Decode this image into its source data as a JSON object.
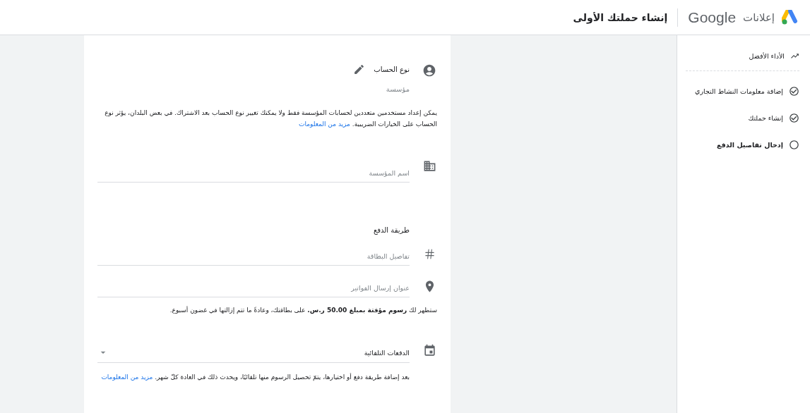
{
  "header": {
    "product": "إعلانات",
    "brand": "Google",
    "title": "إنشاء حملتك الأولى"
  },
  "sidebar": {
    "heading": "الأداء الأفضل",
    "steps": [
      {
        "label": "إضافة معلومات النشاط التجاري",
        "done": true
      },
      {
        "label": "إنشاء حملتك",
        "done": true
      },
      {
        "label": "إدخال تفاصيل الدفع",
        "done": false
      }
    ]
  },
  "form": {
    "account_type": {
      "label": "نوع الحساب",
      "value": "مؤسسة",
      "note": "يمكن إعداد مستخدمين متعددين لحسابات المؤسسة فقط ولا يمكنك تغيير نوع الحساب بعد الاشتراك. في بعض البلدان، يؤثر نوع الحساب على الخيارات الضريبية.",
      "link": "مزيد من المعلومات"
    },
    "organization_name": {
      "placeholder": "اسم المؤسسة"
    },
    "payment": {
      "heading": "طريقة الدفع",
      "card": {
        "placeholder": "تفاصيل البطاقة"
      },
      "billing_address": {
        "placeholder": "عنوان إرسال الفواتير"
      },
      "fee_note": "ستظهر لك **رسوم مؤقتة بمبلغ 50.00 ر.س.** على بطاقتك، وعادةً ما تتم إزالتها في غضون أسبوع.",
      "payments_type": {
        "value": "الدفعات التلقائية"
      },
      "note": "بعد إضافة طريقة دفع أو اختيارها، يتمّ تحصيل الرسوم منها تلقائيًا، ويحدث ذلك في العادة كلّ شهر.",
      "link": "مزيد من المعلومات"
    }
  }
}
